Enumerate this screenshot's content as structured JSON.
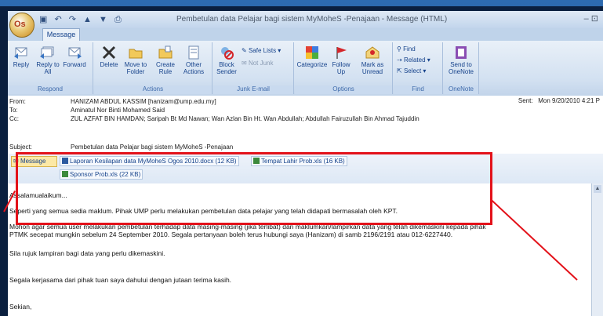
{
  "window": {
    "title": "Pembetulan data Pelajar bagi sistem MyMoheS -Penajaan - Message (HTML)",
    "office_logo_text": "Os",
    "controls": "– ⊡"
  },
  "ribbon": {
    "tab": "Message",
    "groups": {
      "respond": {
        "label": "Respond",
        "reply": "Reply",
        "reply_all": "Reply to All",
        "forward": "Forward"
      },
      "actions": {
        "label": "Actions",
        "delete": "Delete",
        "move": "Move to Folder",
        "create_rule": "Create Rule",
        "other_actions": "Other Actions"
      },
      "junk": {
        "label": "Junk E-mail",
        "block_sender": "Block Sender",
        "safe_lists": "Safe Lists",
        "not_junk": "Not Junk"
      },
      "options": {
        "label": "Options",
        "categorize": "Categorize",
        "follow_up": "Follow Up",
        "mark_unread": "Mark as Unread"
      },
      "find": {
        "label": "Find",
        "find": "Find",
        "related": "Related",
        "select": "Select"
      },
      "onenote": {
        "label": "OneNote",
        "send": "Send to OneNote"
      }
    }
  },
  "header": {
    "from_label": "From:",
    "from_value": "HANIZAM ABDUL KASSIM [hanizam@ump.edu.my]",
    "to_label": "To:",
    "to_value": "Aminatul Nor Binti Mohamed Said",
    "cc_label": "Cc:",
    "cc_value": "ZUL AZFAT BIN HAMDAN; Saripah Bt Md Nawan; Wan Azlan Bin Ht. Wan Abdullah; Abdullah Fairuzullah Bin Ahmad Tajuddin",
    "sent_label": "Sent:",
    "sent_value": "Mon 9/20/2010 4:21 P",
    "subject_label": "Subject:",
    "subject_value": "Pembetulan data Pelajar bagi sistem MyMoheS -Penajaan"
  },
  "attachments": {
    "message_tab": "Message",
    "items": [
      "Laporan Kesilapan data MyMoheS Ogos 2010.docx (12 KB)",
      "Tempat Lahir Prob.xls (16 KB)",
      "Sponsor Prob.xls (22 KB)"
    ]
  },
  "body": {
    "greeting": "Assalamualaikum...",
    "para1": "Seperti yang semua sedia maklum. Pihak UMP perlu melakukan pembetulan data pelajar yang telah didapati bermasalah oleh KPT.",
    "para2_line1": "Mohon agar semua user melakukan pembetulan terhadap data masing-masing (jika terlibat) dan maklumkan/lampirkan data yang telah dikemaskini kepada pihak",
    "para2_line2": "PTMK secepat mungkin sebelum 24 September 2010. Segala pertanyaan boleh terus hubungi saya (Hanizam) di samb 2196/2191 atau 012-6227440.",
    "para3": "Sila rujuk lampiran bagi data yang perlu dikemaskini.",
    "para4": "Segala kerjasama dari pihak tuan saya dahului dengan jutaan terima kasih.",
    "closing": "Sekian,"
  },
  "colors": {
    "highlight": "#e3121a",
    "ribbon": "#d3e1f1",
    "accent": "#15428b"
  }
}
